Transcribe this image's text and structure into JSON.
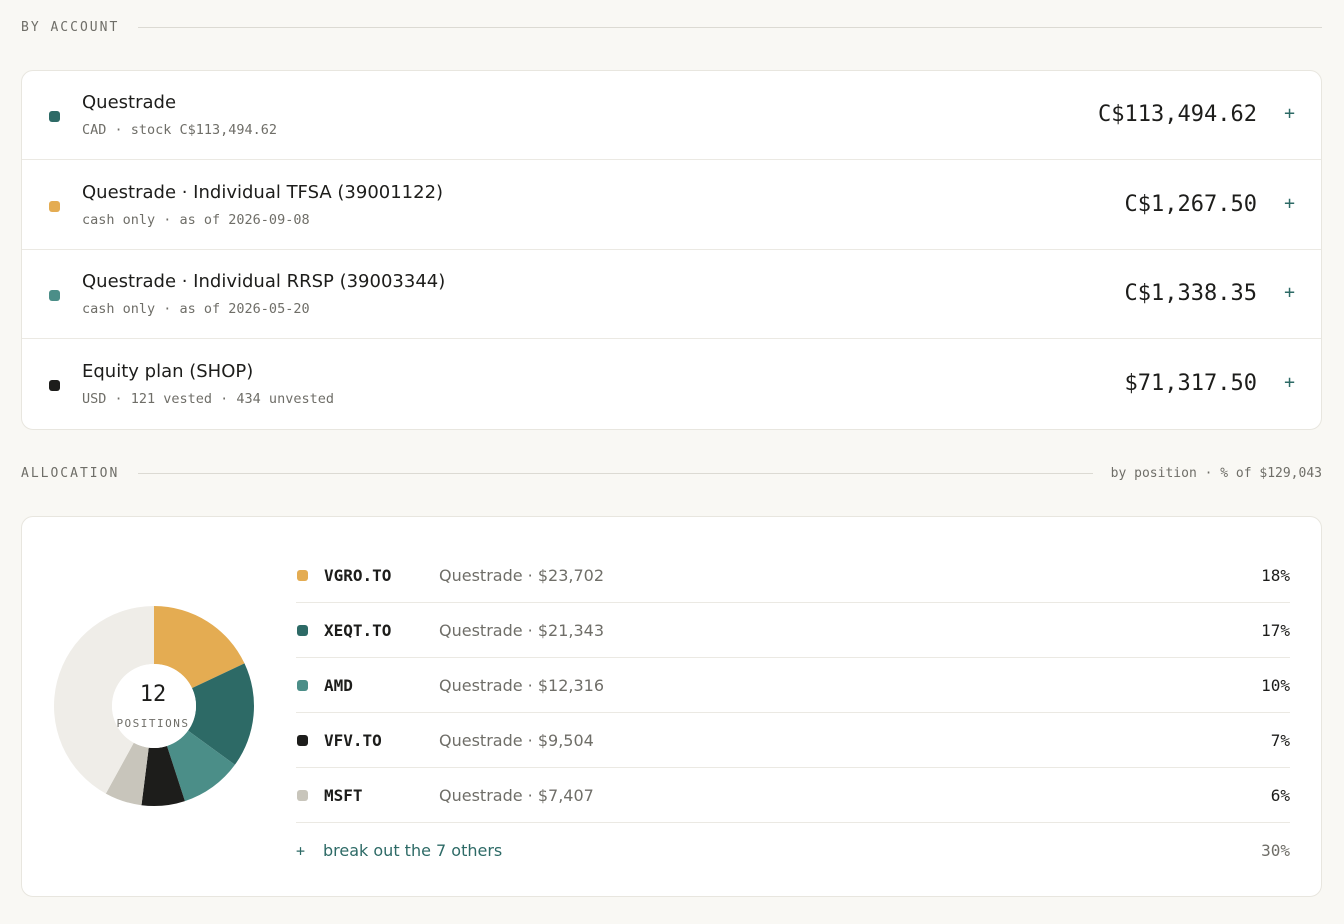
{
  "by_account": {
    "title": "BY ACCOUNT",
    "accounts": [
      {
        "name": "Questrade",
        "sub": "CAD · stock C$113,494.62",
        "value": "C$113,494.62",
        "add": "+",
        "color": "#2d6a66"
      },
      {
        "name": "Questrade · Individual TFSA (39001122)",
        "sub": "cash only · as of 2026-09-08",
        "value": "C$1,267.50",
        "add": "+",
        "color": "#e4ac52"
      },
      {
        "name": "Questrade · Individual RRSP (39003344)",
        "sub": "cash only · as of 2026-05-20",
        "value": "C$1,338.35",
        "add": "+",
        "color": "#4b8e88"
      },
      {
        "name": "Equity plan (SHOP)",
        "sub": "USD · 121 vested · 434 unvested",
        "value": "$71,317.50",
        "add": "+",
        "color": "#1d1d1b"
      }
    ]
  },
  "allocation": {
    "title": "ALLOCATION",
    "meta": "by position · % of $129,043",
    "donut": {
      "count": "12",
      "label": "POSITIONS"
    },
    "positions": [
      {
        "ticker": "VGRO.TO",
        "account": "Questrade · $23,702",
        "pct": "18%",
        "color": "#e4ac52"
      },
      {
        "ticker": "XEQT.TO",
        "account": "Questrade · $21,343",
        "pct": "17%",
        "color": "#2d6a66"
      },
      {
        "ticker": "AMD",
        "account": "Questrade · $12,316",
        "pct": "10%",
        "color": "#4b8e88"
      },
      {
        "ticker": "VFV.TO",
        "account": "Questrade · $9,504",
        "pct": "7%",
        "color": "#1d1d1b"
      },
      {
        "ticker": "MSFT",
        "account": "Questrade · $7,407",
        "pct": "6%",
        "color": "#c8c5bb"
      }
    ],
    "others": {
      "plus": "+",
      "label": "break out the 7 others",
      "pct": "30%",
      "color": "#efede8"
    }
  },
  "chart_data": {
    "type": "pie",
    "categories": [
      "VGRO.TO",
      "XEQT.TO",
      "AMD",
      "VFV.TO",
      "MSFT",
      "7 others"
    ],
    "values": [
      18,
      17,
      10,
      7,
      6,
      42
    ],
    "colors": [
      "#e4ac52",
      "#2d6a66",
      "#4b8e88",
      "#1d1d1b",
      "#c8c5bb",
      "#efede8"
    ]
  }
}
